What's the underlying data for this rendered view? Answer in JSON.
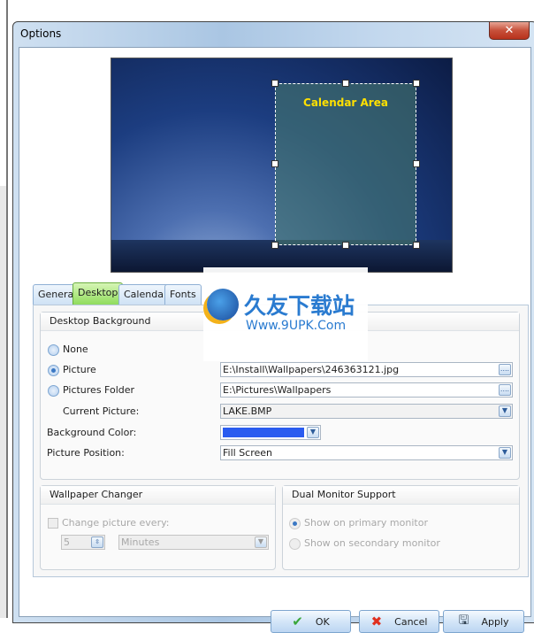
{
  "window": {
    "title": "Options",
    "close_icon": "close-icon"
  },
  "preview": {
    "calendar_area_label": "Calendar Area"
  },
  "tabs": [
    {
      "label": "General"
    },
    {
      "label": "Desktop",
      "active": true
    },
    {
      "label": "Calendar"
    },
    {
      "label": "Fonts"
    }
  ],
  "desktop_background": {
    "title": "Desktop Background",
    "options": [
      {
        "label": "None",
        "selected": false
      },
      {
        "label": "Picture",
        "selected": true
      },
      {
        "label": "Pictures Folder",
        "selected": false
      }
    ],
    "picture_path": "E:\\Install\\Wallpapers\\246363121.jpg",
    "folder_path": "E:\\Pictures\\Wallpapers",
    "current_picture_label": "Current Picture:",
    "current_picture": "LAKE.BMP",
    "background_color_label": "Background Color:",
    "background_color": "#2a5cf0",
    "picture_position_label": "Picture Position:",
    "picture_position": "Fill Screen",
    "browse_label": "...."
  },
  "wallpaper_changer": {
    "title": "Wallpaper Changer",
    "checkbox_label": "Change picture every:",
    "checked": false,
    "interval": "5",
    "unit": "Minutes"
  },
  "dual_monitor": {
    "title": "Dual Monitor Support",
    "options": [
      {
        "label": "Show on primary monitor",
        "selected": true
      },
      {
        "label": "Show on secondary monitor",
        "selected": false
      }
    ]
  },
  "buttons": {
    "ok": "OK",
    "cancel": "Cancel",
    "apply": "Apply"
  },
  "watermark": {
    "text": "久友下载站",
    "url": "Www.9UPK.Com"
  }
}
